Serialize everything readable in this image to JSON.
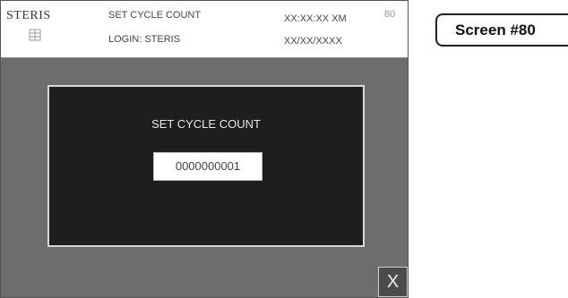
{
  "header": {
    "logo": "STERIS",
    "title": "SET CYCLE COUNT",
    "login": "LOGIN: STERIS",
    "time": "XX:XX:XX XM",
    "date": "XX/XX/XXXX",
    "screen_number": "80"
  },
  "dialog": {
    "title": "SET CYCLE COUNT",
    "count_value": "0000000001"
  },
  "close_button": {
    "label": "X"
  },
  "screen_label": "Screen #80",
  "colors": {
    "screen_background": "#6d6d6d",
    "dialog_background": "#1e1e1e",
    "header_background": "#ffffff"
  },
  "icons": [
    "steris-logo-icon"
  ]
}
